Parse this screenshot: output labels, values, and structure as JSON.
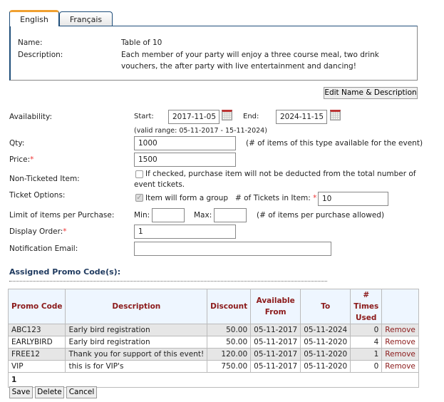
{
  "tabs": [
    {
      "label": "English",
      "active": true
    },
    {
      "label": "Français",
      "active": false
    }
  ],
  "details": {
    "name_label": "Name:",
    "name_value": "Table of 10",
    "description_label": "Description:",
    "description_line1": "Each member of your party will enjoy a three course meal, two drink",
    "description_line2": "vouchers, the after party with live entertainment and dancing!"
  },
  "edit_button": "Edit Name & Description",
  "form": {
    "availability_label": "Availability:",
    "start_label": "Start:",
    "start_value": "2017-11-05",
    "end_label": "End:",
    "end_value": "2024-11-15",
    "valid_range": "(valid range: 05-11-2017 - 15-11-2024)",
    "qty_label": "Qty:",
    "qty_value": "1000",
    "qty_hint": "(# of items of this type available for the event)",
    "price_label": "Price:",
    "price_value": "1500",
    "required_mark": "*",
    "non_ticketed_label": "Non-Ticketed Item:",
    "non_ticketed_checked": false,
    "non_ticketed_text1": "If checked, purchase item will not be deducted from the total number of",
    "non_ticketed_text2": "event tickets.",
    "ticket_options_label": "Ticket Options:",
    "group_checked": true,
    "group_text": "Item will form a group",
    "tickets_in_item_label": "# of Tickets in Item:",
    "tickets_in_item_value": "10",
    "limit_label": "Limit of items per Purchase:",
    "min_label": "Min:",
    "min_value": "",
    "max_label": "Max:",
    "max_value": "",
    "limit_hint": "(# of items per purchase allowed)",
    "display_order_label": "Display Order:",
    "display_order_value": "1",
    "notification_label": "Notification Email:",
    "notification_value": ""
  },
  "promo": {
    "heading": "Assigned Promo Code(s):",
    "headers": [
      "Promo Code",
      "Description",
      "Discount",
      "Available From",
      "To",
      "# Times Used",
      ""
    ],
    "rows": [
      [
        "ABC123",
        "Early bird registration",
        "50.00",
        "05-11-2017",
        "05-11-2024",
        "0",
        "Remove"
      ],
      [
        "EARLYBIRD",
        "Early bird registration",
        "50.00",
        "05-11-2017",
        "05-11-2020",
        "4",
        "Remove"
      ],
      [
        "FREE12",
        "Thank you for support of this event!",
        "120.00",
        "05-11-2017",
        "05-11-2020",
        "1",
        "Remove"
      ],
      [
        "VIP",
        "this is for VIP's",
        "750.00",
        "05-11-2017",
        "05-11-2020",
        "0",
        "Remove"
      ]
    ],
    "page": "1"
  },
  "buttons": {
    "save": "Save",
    "delete": "Delete",
    "cancel": "Cancel"
  }
}
